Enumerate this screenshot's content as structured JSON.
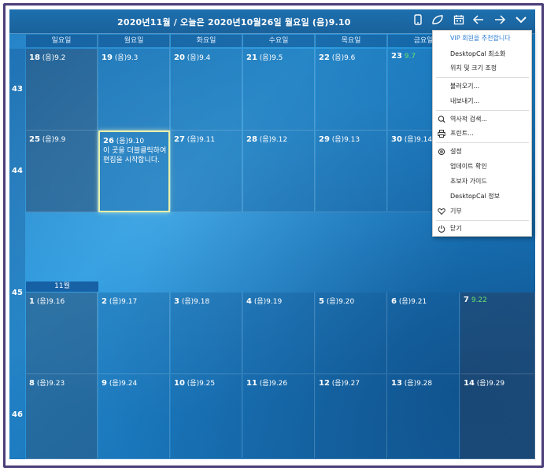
{
  "title": "2020년11월 / 오늘은 2020년10월26일 월요일 (음)9.10",
  "toolbar_icons": [
    "phone-icon",
    "leaf-icon",
    "calendar-icon",
    "arrow-left-icon",
    "arrow-right-icon",
    "chevron-down-icon"
  ],
  "weekdays": [
    "일요일",
    "월요일",
    "화요일",
    "수요일",
    "목요일",
    "금요일"
  ],
  "week_numbers": [
    "43",
    "44",
    "45",
    "46"
  ],
  "month_tag": "11월",
  "week1": [
    {
      "day": "18",
      "lunar": "(음)9.2"
    },
    {
      "day": "19",
      "lunar": "(음)9.3"
    },
    {
      "day": "20",
      "lunar": "(음)9.4"
    },
    {
      "day": "21",
      "lunar": "(음)9.5"
    },
    {
      "day": "22",
      "lunar": "(음)9.6"
    },
    {
      "day": "23",
      "lunar": "9.7"
    }
  ],
  "week2": [
    {
      "day": "25",
      "lunar": "(음)9.9"
    },
    {
      "day": "26",
      "lunar": "(음)9.10"
    },
    {
      "day": "27",
      "lunar": "(음)9.11"
    },
    {
      "day": "28",
      "lunar": "(음)9.12"
    },
    {
      "day": "29",
      "lunar": "(음)9.13"
    },
    {
      "day": "30",
      "lunar": "(음)9.14"
    }
  ],
  "today_note": "이 곳을 더블클릭하여 편집을 시작합니다.",
  "week3": [
    {
      "day": "1",
      "lunar": "(음)9.16"
    },
    {
      "day": "2",
      "lunar": "(음)9.17"
    },
    {
      "day": "3",
      "lunar": "(음)9.18"
    },
    {
      "day": "4",
      "lunar": "(음)9.19"
    },
    {
      "day": "5",
      "lunar": "(음)9.20"
    },
    {
      "day": "6",
      "lunar": "(음)9.21"
    },
    {
      "day": "7",
      "lunar": "9.22"
    }
  ],
  "week4": [
    {
      "day": "8",
      "lunar": "(음)9.23"
    },
    {
      "day": "9",
      "lunar": "(음)9.24"
    },
    {
      "day": "10",
      "lunar": "(음)9.25"
    },
    {
      "day": "11",
      "lunar": "(음)9.26"
    },
    {
      "day": "12",
      "lunar": "(음)9.27"
    },
    {
      "day": "13",
      "lunar": "(음)9.28"
    },
    {
      "day": "14",
      "lunar": "(음)9.29"
    }
  ],
  "menu": {
    "vip": "VIP 회원을 추천합니다",
    "minimize": "DesktopCal 최소화",
    "position": "위치 및 크기 조정",
    "import": "불러오기...",
    "export": "내보내기...",
    "search": "역사적 검색...",
    "print": "프린트...",
    "settings": "설정",
    "update": "업데이트 확인",
    "guide": "초보자 가이드",
    "about": "DesktopCal 정보",
    "donate": "기부",
    "close": "닫기"
  }
}
